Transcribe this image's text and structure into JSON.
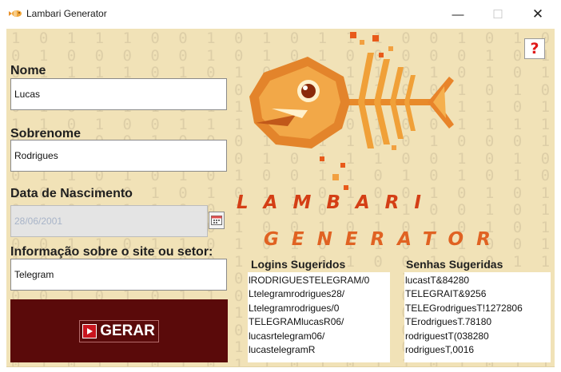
{
  "window": {
    "title": "Lambari Generator",
    "minimize_glyph": "—",
    "maximize_glyph": "☐",
    "close_glyph": "✕"
  },
  "background_binary": [
    "1 0 1 1 1 0 0 1 0 1 0 1 1 1 0 0 1 0 1 0 1 1 1 0 0 1 0",
    "0 1 0 0 0 0 0 1 0 1 0 1 0 0 0 0 0 1 0 1 0 1 1 0 0 0 1",
    "0 1 1 1 1 0 1 0 1 0 1 1 1 1 0 1 0 1 0 1 1 1 1 0 1 0 0",
    "1 0 1 1 1 0 0 1 0 1 0 1 1 1 0 0 1 0 1 0 1 1 1 0 0 1 1",
    "0 1 0 1 1 1 0 1 1 0 1 0 1 1 1 0 1 1 0 1 0 1 1 1 0 1 0",
    "1 1 0 1 0 0 1 1 1 1 1 1 0 1 0 0 1 1 1 1 1 0 1 0 0 1 1",
    "0 1 1 0 0 1 0 0 0 1 0 1 1 0 0 1 0 0 0 1 0 1 1 0 0 1 0",
    "1 0 1 1 1 0 0 1 0 1 0 1 1 1 0 0 1 0 1 0 1 1 1 0 0 1 0",
    "0 1 1 0 1 0 1 0 1 0 0 1 1 0 1 0 1 0 1 0 0 1 1 0 1 0 1",
    "1 0 1 0 0 1 0 1 0 1 1 0 1 0 0 1 0 1 0 1 1 0 1 0 0 1 1",
    "0 1 0 1 1 1 0 0 1 0 1 0 1 1 1 0 0 1 0 1 0 1 1 1 0 0 0",
    "1 1 0 1 0 0 1 0 1 0 0 1 0 1 0 1 0 1 0 1 0 1 0 1 1 1 1",
    "0 0 1 1 0 1 1 0 1 0 1 0 1 1 0 1 1 0 0 1 1 1 0 1 1 0 0",
    "1 0 1 0 0 1 0 0 1 1 1 0 1 0 0 1 0 0 1 1 1 0 1 0 0 1 0",
    "1 1 0 0 1 0 1 1 0 1 0 1 0 0 1 0 1 1 0 1 0 1 0 0 1 0 0",
    "0 0 1 0 1 0 1 1 0 0 1 0 0 1 0 1 1 0 0 1 1 0 1 0 1 1 0",
    "1 0 1 0 0 1 1 0 1 0 1 1 0 1 0 1 1 0 1 0 1 1 0 1 0 1 0",
    "0 1 0 1 0 1 0 1 0 1 0 1 0 1 0 1 0 1 0 1 0 1 0 1 0 1 0",
    "1 0 1 1 0 1 0 1 1 0 1 0 1 1 0 1 0 1 1 0 1 0 1 1 0 1 1",
    "0 1 0 1 1 0 1 0 1 1 0 1 0 1 1 0 1 0 1 1 0 1 0 1 1 0 1"
  ],
  "help": {
    "glyph": "?"
  },
  "form": {
    "nome_label": "Nome",
    "nome_value": "Lucas",
    "sobrenome_label": "Sobrenome",
    "sobrenome_value": "Rodrigues",
    "data_label": "Data de Nascimento",
    "data_value": "28/06/2001",
    "info_label": "Informação sobre o site ou setor:",
    "info_value": "Telegram"
  },
  "gerar": {
    "label": "GERAR"
  },
  "logo": {
    "line1": "LAMBARI",
    "line2": "GENERATOR"
  },
  "logins": {
    "title": "Logins Sugeridos",
    "items": [
      "lRODRIGUESTELEGRAM/0",
      "Ltelegramrodrigues28/",
      "Ltelegramrodrigues/0",
      "TELEGRAMlucasR06/",
      "lucasrtelegram06/",
      "lucastelegramR"
    ]
  },
  "senhas": {
    "title": "Senhas Sugeridas",
    "items": [
      "lucastT&84280",
      "TELEGRAIT&9256",
      "TELEGrodriguesT!1272806",
      "TErodriguesT.78180",
      "rodriguestT(038280",
      "rodriguesT,0016"
    ]
  },
  "colors": {
    "background": "#f1e2b7",
    "binary_digits": "#ddcea7",
    "gerar_panel": "#5a0a0a",
    "logo_red": "#d43e15",
    "logo_orange": "#e06222",
    "help_red": "#e01818"
  }
}
